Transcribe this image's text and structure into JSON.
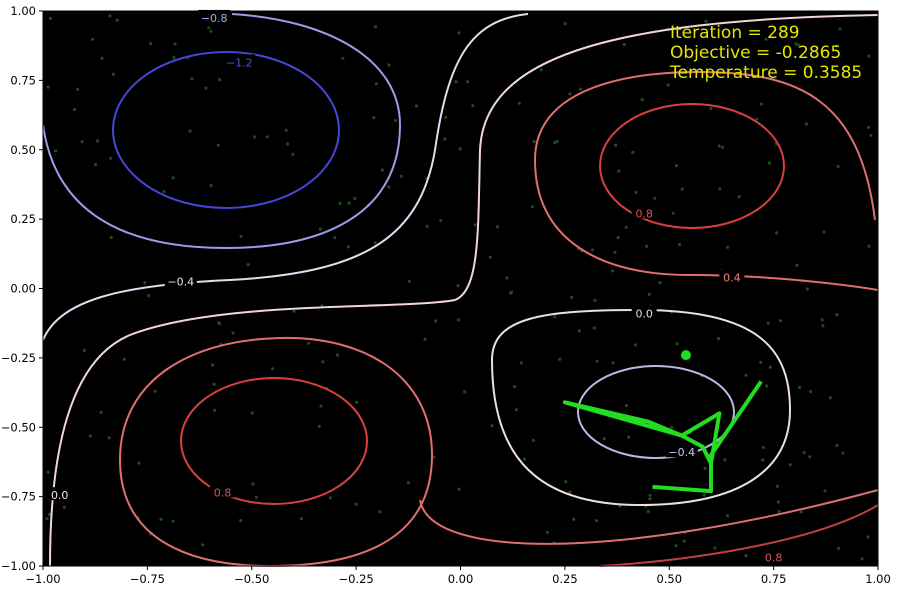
{
  "chart_data": {
    "type": "contour",
    "xlim": [
      -1.0,
      1.0
    ],
    "ylim": [
      -1.0,
      1.0
    ],
    "xticks": [
      "−1.00",
      "−0.75",
      "−0.50",
      "−0.25",
      "0.00",
      "0.25",
      "0.50",
      "0.75",
      "1.00"
    ],
    "xtick_values": [
      -1.0,
      -0.75,
      -0.5,
      -0.25,
      0.0,
      0.25,
      0.5,
      0.75,
      1.0
    ],
    "yticks": [
      "−1.00",
      "−0.75",
      "−0.50",
      "−0.25",
      "0.00",
      "0.25",
      "0.50",
      "0.75",
      "1.00"
    ],
    "ytick_values": [
      -1.0,
      -0.75,
      -0.5,
      -0.25,
      0.0,
      0.25,
      0.5,
      0.75,
      1.0
    ],
    "background": "#000000",
    "grid": false,
    "contour_levels": [
      -1.2,
      -0.8,
      -0.4,
      0.0,
      0.4,
      0.8
    ],
    "contour_labels": [
      {
        "text": "−0.8",
        "x": -0.59,
        "y": 0.975,
        "color": "#a8a8f0"
      },
      {
        "text": "−1.2",
        "x": -0.53,
        "y": 0.815,
        "color": "#5050e0"
      },
      {
        "text": "−0.4",
        "x": -0.67,
        "y": 0.025,
        "color": "#e6e6f0"
      },
      {
        "text": "0.0",
        "x": 0.44,
        "y": -0.09,
        "color": "#f0dada"
      },
      {
        "text": "0.4",
        "x": 0.65,
        "y": 0.04,
        "color": "#f08070"
      },
      {
        "text": "0.8",
        "x": 0.44,
        "y": 0.27,
        "color": "#e05050"
      },
      {
        "text": "0.8",
        "x": -0.57,
        "y": -0.735,
        "color": "#e05050"
      },
      {
        "text": "0.0",
        "x": -0.96,
        "y": -0.745,
        "color": "#f0e8e8"
      },
      {
        "text": "−0.4",
        "x": 0.53,
        "y": -0.59,
        "color": "#c8c8f0"
      },
      {
        "text": "0.8",
        "x": 0.75,
        "y": -0.97,
        "color": "#e05050"
      }
    ],
    "series": [
      {
        "name": "",
        "type": "line",
        "color": "#22dd22",
        "points": [
          [
            0.72,
            -0.335
          ],
          [
            0.6,
            -0.6
          ],
          [
            0.6,
            -0.63
          ],
          [
            0.62,
            -0.45
          ],
          [
            0.53,
            -0.53
          ],
          [
            0.25,
            -0.41
          ],
          [
            0.45,
            -0.48
          ],
          [
            0.53,
            -0.53
          ],
          [
            0.58,
            -0.57
          ],
          [
            0.6,
            -0.63
          ],
          [
            0.6,
            -0.73
          ],
          [
            0.46,
            -0.715
          ]
        ]
      },
      {
        "name": "",
        "type": "scatter",
        "color": "#22dd22",
        "points": [
          [
            0.54,
            -0.24
          ]
        ]
      }
    ]
  },
  "annotations": {
    "iteration": "Iteration = 289",
    "objective": "Objective = -0.2865",
    "temperature": "Temperature = 0.3585"
  }
}
